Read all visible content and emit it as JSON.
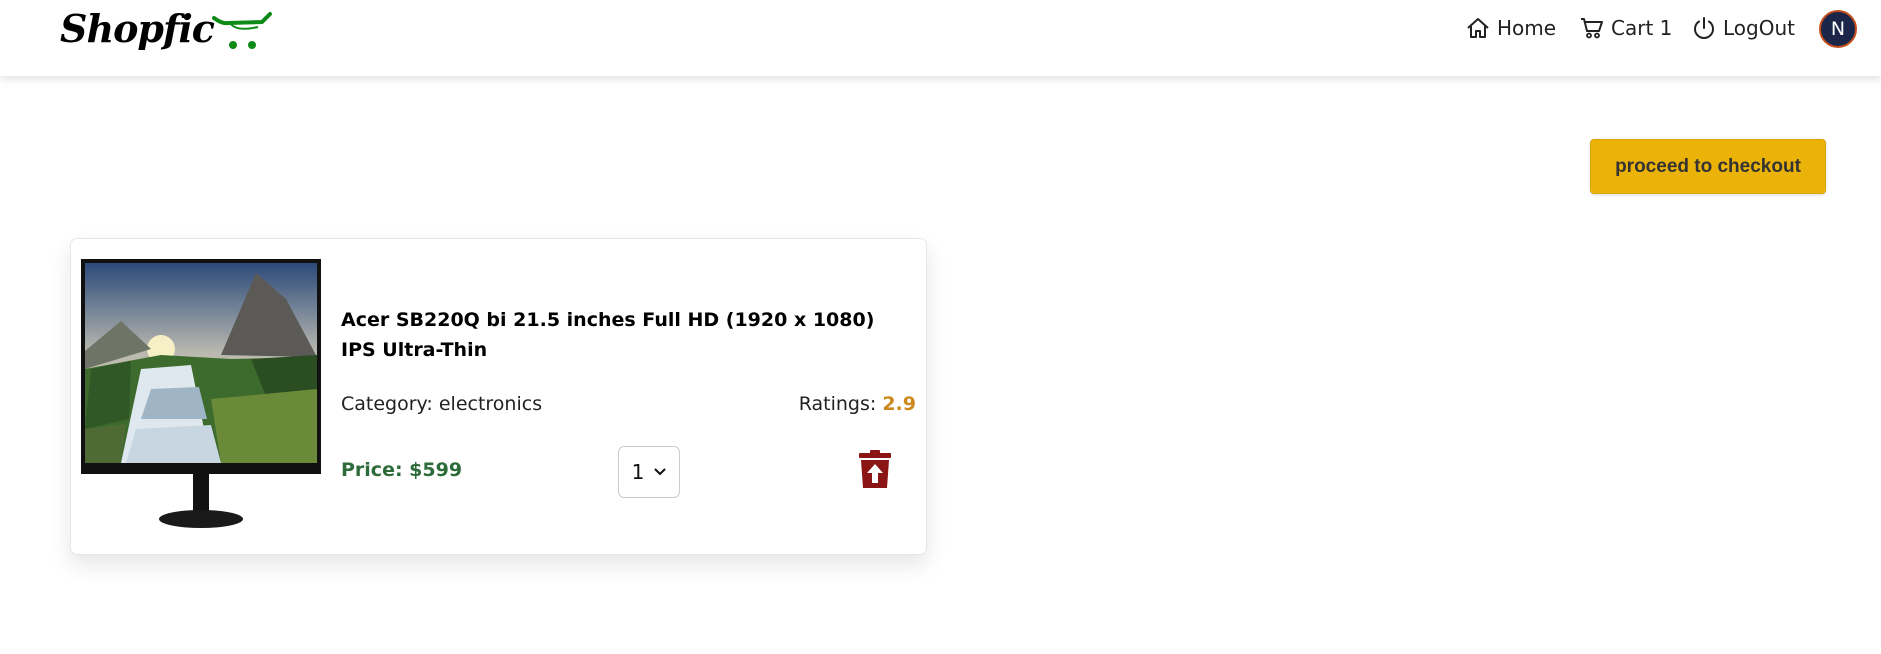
{
  "brand": {
    "name": "Shopfic",
    "cart_icon": "cart-icon",
    "cart_color": "#0e8a16"
  },
  "nav": {
    "home_label": "Home",
    "cart_label": "Cart 1",
    "logout_label": "LogOut",
    "avatar_initial": "N"
  },
  "checkout": {
    "label": "proceed to checkout",
    "color": "#ebb308"
  },
  "cart_items": [
    {
      "title": "Acer SB220Q bi 21.5 inches Full HD (1920 x 1080) IPS Ultra-Thin",
      "category_label": "Category: electronics",
      "ratings_label": "Ratings: ",
      "ratings_value": "2.9",
      "price_label": "Price: $599",
      "quantity": "1",
      "image": "monitor-with-waterfall-landscape",
      "delete_icon": "trash-icon"
    }
  ],
  "colors": {
    "price": "#2e6b3a",
    "rating": "#cc8a1e",
    "delete": "#8b1414",
    "avatar_bg": "#1a2547",
    "avatar_border": "#c2501f"
  }
}
